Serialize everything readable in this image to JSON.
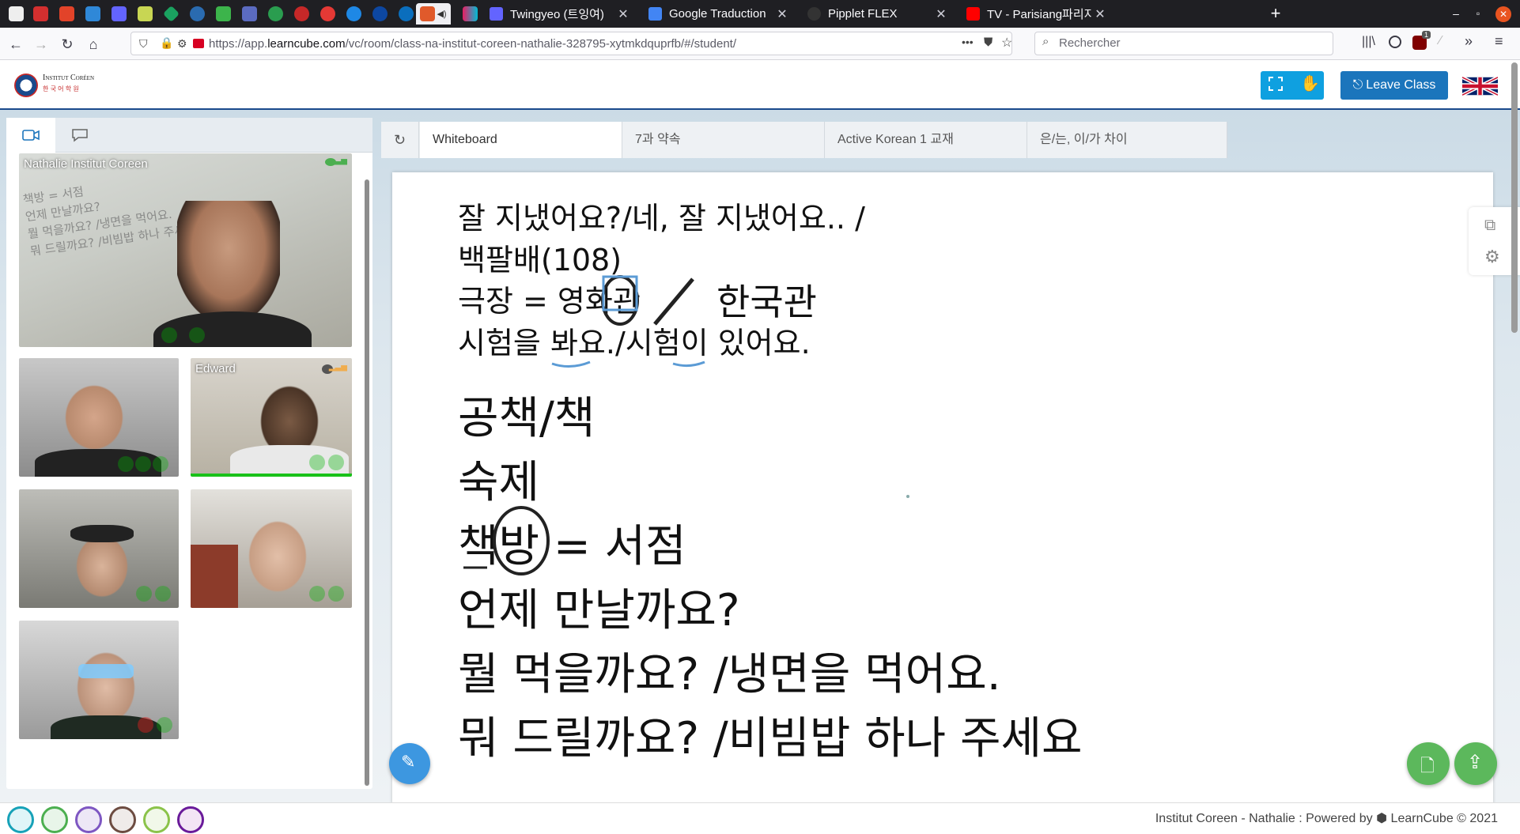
{
  "browser": {
    "tabs": [
      {
        "label": "Twingyeo (트잉여)",
        "color": "#6364ff"
      },
      {
        "label": "Google Traduction",
        "color": "#4285f4"
      },
      {
        "label": "Pipplet FLEX",
        "color": "#333"
      },
      {
        "label": "TV - Parisiang파리지앙 - Y",
        "color": "#ff0000"
      }
    ],
    "url_prefix": "https://app.",
    "url_domain": "learncube.com",
    "url_path": "/vc/room/class-na-institut-coreen-nathalie-328795-xytmkdquprfb/#/student/",
    "search_placeholder": "Rechercher",
    "more_label": "•••",
    "ublock_badge": "1"
  },
  "header": {
    "logo_name": "Institut Coréen",
    "logo_sub": "한 국 어 학 원",
    "leave_label": "Leave Class",
    "flag": "UK"
  },
  "participants": [
    {
      "name": "Nathalie Institut Coreen",
      "main": true
    },
    {
      "name": ""
    },
    {
      "name": "Edward"
    },
    {
      "name": ""
    },
    {
      "name": ""
    },
    {
      "name": ""
    }
  ],
  "whiteboard": {
    "tabs": [
      "Whiteboard",
      "7과 약속",
      "Active Korean 1 교재",
      "은/는, 이/가 차이"
    ],
    "lines_small": [
      "잘 지냈어요?/네, 잘 지냈어요.. /",
      "백팔배(108)",
      "극장 = 영화관",
      "한국관",
      "시험을 봐요./시험이 있어요."
    ],
    "lines_large": [
      "공책/책",
      "숙제",
      "책방 = 서점",
      "언제 만날까요?",
      "뭘 먹을까요? /냉면을 먹어요.",
      "뭐 드릴까요? /비빔밥 하나 주세요"
    ]
  },
  "footer": {
    "room_owner": "Institut Coreen - Nathalie :",
    "powered_by": "Powered by",
    "brand": "LearnCube",
    "copyright": "© 2021",
    "avatar_colors": [
      "#17a2b8",
      "#4caf50",
      "#7e57c2",
      "#6d4c41",
      "#8bc34a",
      "#6a1b9a"
    ]
  },
  "colors": {
    "accent_blue": "#1b75bc",
    "fullscreen_blue": "#0fa0e0",
    "green_fab": "#5cb85c",
    "pen_blue": "#3d97e0"
  }
}
